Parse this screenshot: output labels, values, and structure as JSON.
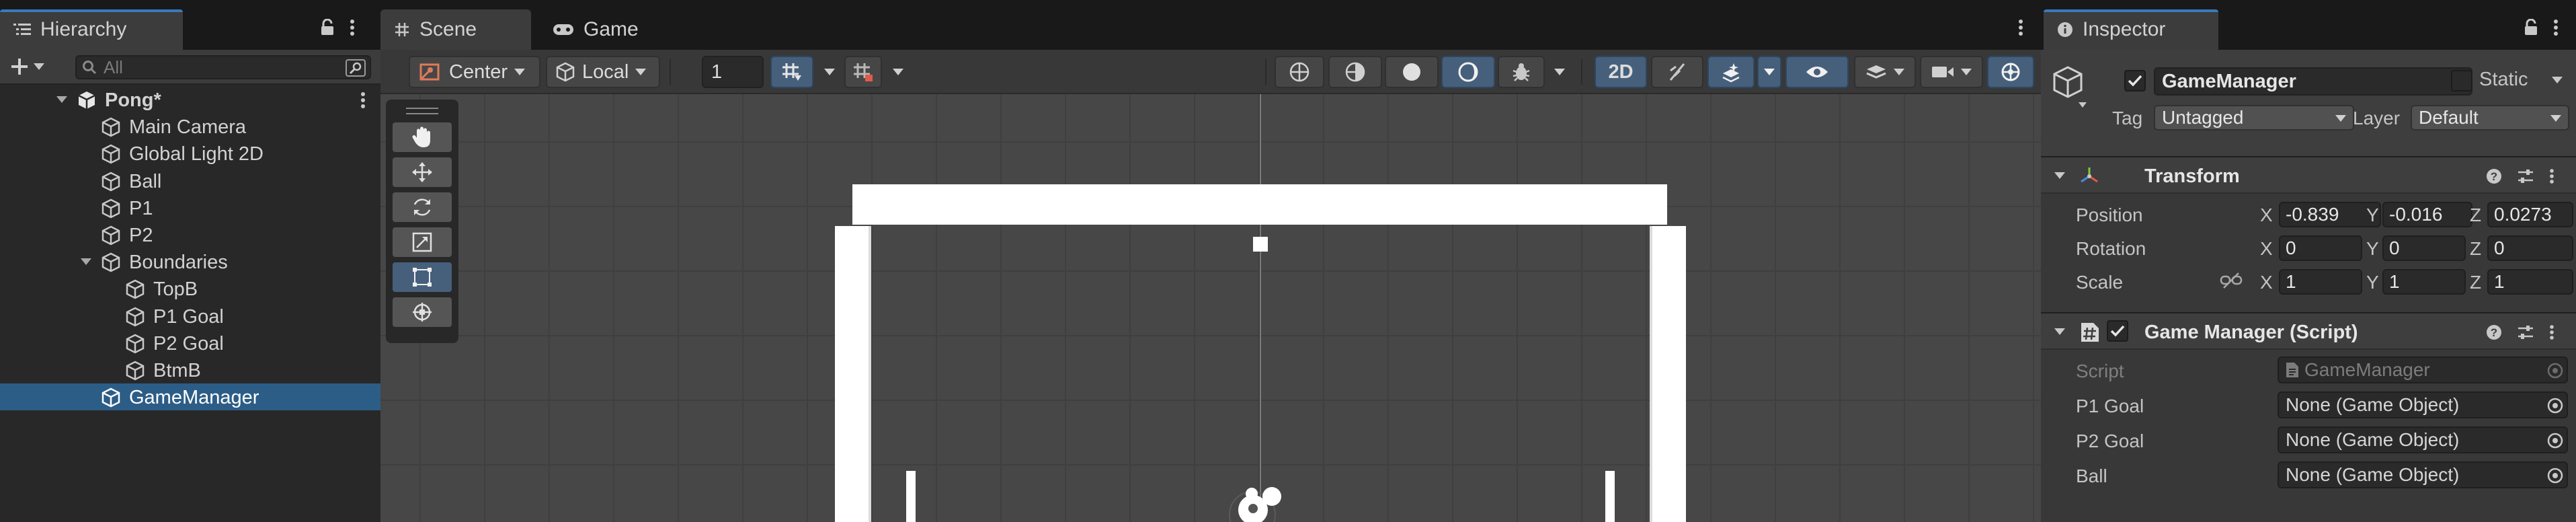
{
  "hierarchy": {
    "tab_label": "Hierarchy",
    "search_placeholder": "All",
    "scene_name": "Pong*",
    "items": [
      {
        "label": "Main Camera"
      },
      {
        "label": "Global Light 2D"
      },
      {
        "label": "Ball"
      },
      {
        "label": "P1"
      },
      {
        "label": "P2"
      },
      {
        "label": "Boundaries"
      },
      {
        "label": "TopB"
      },
      {
        "label": "P1 Goal"
      },
      {
        "label": "P2 Goal"
      },
      {
        "label": "BtmB"
      },
      {
        "label": "GameManager"
      }
    ],
    "selected": "GameManager"
  },
  "scene": {
    "tabs": [
      {
        "label": "Scene"
      },
      {
        "label": "Game"
      }
    ],
    "active_tab": "Scene",
    "toolbar": {
      "pivot_label": "Center",
      "space_label": "Local",
      "grid_value": "1",
      "mode_2d_label": "2D"
    }
  },
  "inspector": {
    "tab_label": "Inspector",
    "object_name": "GameManager",
    "active": true,
    "static_label": "Static",
    "static": false,
    "tag_label": "Tag",
    "tag_value": "Untagged",
    "layer_label": "Layer",
    "layer_value": "Default",
    "transform": {
      "title": "Transform",
      "position_label": "Position",
      "rotation_label": "Rotation",
      "scale_label": "Scale",
      "axis_x": "X",
      "axis_y": "Y",
      "axis_z": "Z",
      "position": {
        "x": "-0.839",
        "y": "-0.016",
        "z": "0.0273"
      },
      "rotation": {
        "x": "0",
        "y": "0",
        "z": "0"
      },
      "scale": {
        "x": "1",
        "y": "1",
        "z": "1"
      }
    },
    "script_component": {
      "title": "Game Manager (Script)",
      "script_label": "Script",
      "script_value": "GameManager",
      "fields": [
        {
          "label": "P1 Goal",
          "value": "None (Game Object)"
        },
        {
          "label": "P2 Goal",
          "value": "None (Game Object)"
        },
        {
          "label": "Ball",
          "value": "None (Game Object)"
        }
      ]
    }
  },
  "colors": {
    "selection": "#2c5d87",
    "accent": "#3a79bb",
    "toggle_on": "#46607c"
  }
}
